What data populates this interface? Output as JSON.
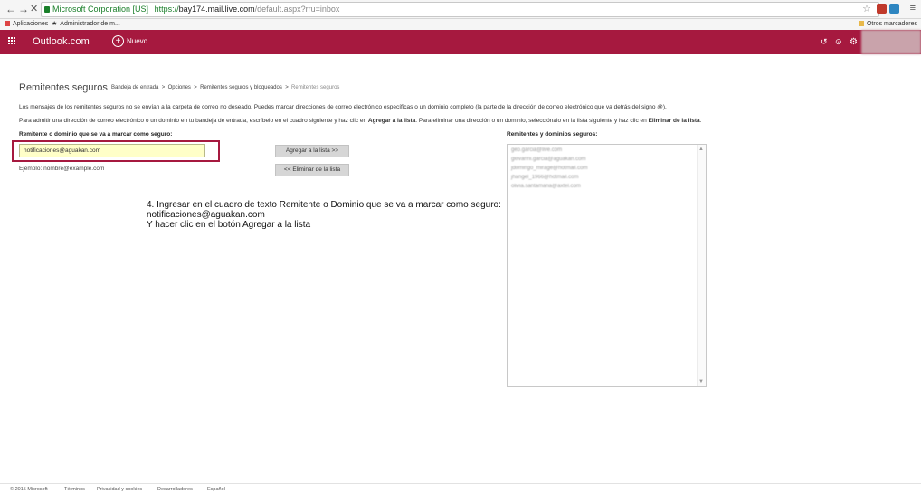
{
  "browser": {
    "security_label": "Microsoft Corporation [US]",
    "url_scheme": "https://",
    "url_host": "bay174.mail.live.com",
    "url_path": "/default.aspx?rru=inbox",
    "bookmarks": [
      "Aplicaciones",
      "Administrador de m..."
    ],
    "other_bookmarks": "Otros marcadores"
  },
  "header": {
    "brand": "Outlook.com",
    "new_label": "Nuevo"
  },
  "page": {
    "title": "Remitentes seguros",
    "breadcrumb": [
      "Bandeja de entrada",
      "Opciones",
      "Remitentes seguros y bloqueados",
      "Remitentes seguros"
    ],
    "para1": "Los mensajes de los remitentes seguros no se envían a la carpeta de correo no deseado. Puedes marcar direcciones de correo electrónico específicas o un dominio completo (la parte de la dirección de correo electrónico que va detrás del signo @).",
    "para2_a": "Para admitir una dirección de correo electrónico o un dominio en tu bandeja de entrada, escríbelo en el cuadro siguiente y haz clic en ",
    "para2_b": "Agregar a la lista",
    "para2_c": ". Para eliminar una dirección o un dominio, selecciónalo en la lista siguiente y haz clic en ",
    "para2_d": "Eliminar de la lista",
    "para2_e": ".",
    "field_label": "Remitente o dominio que se va a marcar como seguro:",
    "input_value": "notificaciones@aguakan.com",
    "example": "Ejemplo: nombre@example.com",
    "add_button": "Agregar a la lista >>",
    "remove_button": "<< Eliminar de la lista",
    "list_label": "Remitentes y dominios seguros:",
    "list_items": [
      "geo.garcia@live.com",
      "giovanni.garcia@aguakan.com",
      "jdomingo_mirage@hotmail.com",
      "jhangel_1966@hotmail.com",
      "olivia.santamaria@axtel.com"
    ]
  },
  "annotation": {
    "line1": "4. Ingresar en el cuadro de texto Remitente o Dominio que se va a marcar como seguro:",
    "line2": "notificaciones@aguakan.com",
    "line3": "Y hacer clic en el botón Agregar a la lista"
  },
  "footer": {
    "items": [
      "© 2015 Microsoft",
      "Términos",
      "Privacidad y cookies",
      "Desarrolladores",
      "Español"
    ]
  },
  "colors": {
    "brand": "#a6193f",
    "input_bg": "#ffffc8"
  }
}
